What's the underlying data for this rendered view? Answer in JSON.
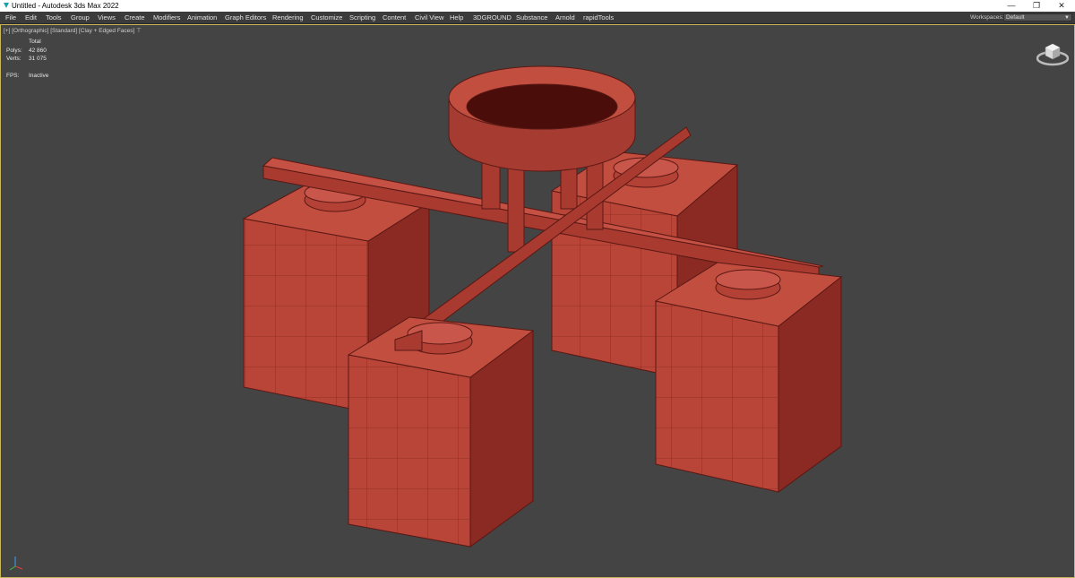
{
  "window": {
    "title": "Untitled - Autodesk 3ds Max 2022",
    "minimize_glyph": "—",
    "maximize_glyph": "❐",
    "close_glyph": "✕"
  },
  "menu": [
    "File",
    "Edit",
    "Tools",
    "Group",
    "Views",
    "Create",
    "Modifiers",
    "Animation",
    "Graph Editors",
    "Rendering",
    "Customize",
    "Scripting",
    "Content",
    "Civil View",
    "Help",
    "3DGROUND",
    "Substance",
    "Arnold",
    "rapidTools"
  ],
  "workspace": {
    "label": "Workspaces:",
    "value": "Default"
  },
  "viewport": {
    "label": "[+] [Orthographic] [Standard] [Clay + Edged Faces]",
    "filter_glyph": "⊤",
    "stats": {
      "header": "Total",
      "polys_label": "Polys:",
      "polys_value": "42 860",
      "verts_label": "Verts:",
      "verts_value": "31 075",
      "fps_label": "FPS:",
      "fps_value": "Inactive"
    },
    "border_color": "#c8b65a",
    "clay_color": "#b5443a"
  }
}
